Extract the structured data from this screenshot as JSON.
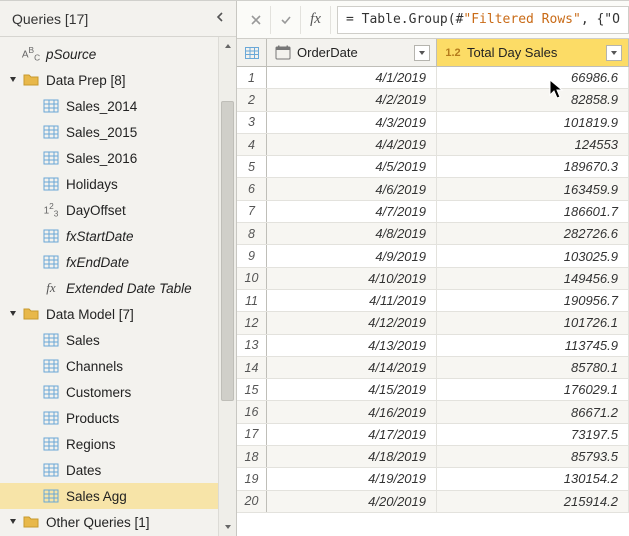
{
  "panel": {
    "title": "Queries [17]"
  },
  "tree": [
    {
      "id": "pSource",
      "label": "pSource",
      "indent": 0,
      "icon": "abc",
      "arrow": "",
      "selected": false,
      "italic": true
    },
    {
      "id": "dataprep",
      "label": "Data Prep [8]",
      "indent": 0,
      "icon": "folder",
      "arrow": "down",
      "selected": false
    },
    {
      "id": "s14",
      "label": "Sales_2014",
      "indent": 1,
      "icon": "table",
      "arrow": "",
      "selected": false
    },
    {
      "id": "s15",
      "label": "Sales_2015",
      "indent": 1,
      "icon": "table",
      "arrow": "",
      "selected": false
    },
    {
      "id": "s16",
      "label": "Sales_2016",
      "indent": 1,
      "icon": "table",
      "arrow": "",
      "selected": false
    },
    {
      "id": "hol",
      "label": "Holidays",
      "indent": 1,
      "icon": "table",
      "arrow": "",
      "selected": false
    },
    {
      "id": "dayoff",
      "label": "DayOffset",
      "indent": 1,
      "icon": "num",
      "arrow": "",
      "selected": false
    },
    {
      "id": "fxstart",
      "label": "fxStartDate",
      "indent": 1,
      "icon": "table",
      "arrow": "",
      "selected": false,
      "italic": true
    },
    {
      "id": "fxend",
      "label": "fxEndDate",
      "indent": 1,
      "icon": "table",
      "arrow": "",
      "selected": false,
      "italic": true
    },
    {
      "id": "ext",
      "label": "Extended Date Table",
      "indent": 1,
      "icon": "fx",
      "arrow": "",
      "selected": false,
      "italic": true
    },
    {
      "id": "dm",
      "label": "Data Model [7]",
      "indent": 0,
      "icon": "folder",
      "arrow": "down",
      "selected": false
    },
    {
      "id": "sales",
      "label": "Sales",
      "indent": 1,
      "icon": "table",
      "arrow": "",
      "selected": false
    },
    {
      "id": "chan",
      "label": "Channels",
      "indent": 1,
      "icon": "table",
      "arrow": "",
      "selected": false
    },
    {
      "id": "cust",
      "label": "Customers",
      "indent": 1,
      "icon": "table",
      "arrow": "",
      "selected": false
    },
    {
      "id": "prod",
      "label": "Products",
      "indent": 1,
      "icon": "table",
      "arrow": "",
      "selected": false
    },
    {
      "id": "reg",
      "label": "Regions",
      "indent": 1,
      "icon": "table",
      "arrow": "",
      "selected": false
    },
    {
      "id": "dates",
      "label": "Dates",
      "indent": 1,
      "icon": "table",
      "arrow": "",
      "selected": false
    },
    {
      "id": "sagg",
      "label": "Sales Agg",
      "indent": 1,
      "icon": "table",
      "arrow": "",
      "selected": true
    },
    {
      "id": "oq",
      "label": "Other Queries [1]",
      "indent": 0,
      "icon": "folder",
      "arrow": "down",
      "selected": false
    }
  ],
  "formula": {
    "prefix": "= Table.Group(#",
    "quoted": "\"Filtered Rows\"",
    "suffix": ", {\"O"
  },
  "columns": {
    "c1": "OrderDate",
    "c2": "Total Day Sales"
  },
  "rows": [
    {
      "n": "1",
      "d": "4/1/2019",
      "v": "66986.6"
    },
    {
      "n": "2",
      "d": "4/2/2019",
      "v": "82858.9"
    },
    {
      "n": "3",
      "d": "4/3/2019",
      "v": "101819.9"
    },
    {
      "n": "4",
      "d": "4/4/2019",
      "v": "124553"
    },
    {
      "n": "5",
      "d": "4/5/2019",
      "v": "189670.3"
    },
    {
      "n": "6",
      "d": "4/6/2019",
      "v": "163459.9"
    },
    {
      "n": "7",
      "d": "4/7/2019",
      "v": "186601.7"
    },
    {
      "n": "8",
      "d": "4/8/2019",
      "v": "282726.6"
    },
    {
      "n": "9",
      "d": "4/9/2019",
      "v": "103025.9"
    },
    {
      "n": "10",
      "d": "4/10/2019",
      "v": "149456.9"
    },
    {
      "n": "11",
      "d": "4/11/2019",
      "v": "190956.7"
    },
    {
      "n": "12",
      "d": "4/12/2019",
      "v": "101726.1"
    },
    {
      "n": "13",
      "d": "4/13/2019",
      "v": "113745.9"
    },
    {
      "n": "14",
      "d": "4/14/2019",
      "v": "85780.1"
    },
    {
      "n": "15",
      "d": "4/15/2019",
      "v": "176029.1"
    },
    {
      "n": "16",
      "d": "4/16/2019",
      "v": "86671.2"
    },
    {
      "n": "17",
      "d": "4/17/2019",
      "v": "73197.5"
    },
    {
      "n": "18",
      "d": "4/18/2019",
      "v": "85793.5"
    },
    {
      "n": "19",
      "d": "4/19/2019",
      "v": "130154.2"
    },
    {
      "n": "20",
      "d": "4/20/2019",
      "v": "215914.2"
    }
  ],
  "chart_data": {
    "type": "table",
    "title": "Sales Agg",
    "columns": [
      "OrderDate",
      "Total Day Sales"
    ],
    "rows": [
      [
        "4/1/2019",
        66986.6
      ],
      [
        "4/2/2019",
        82858.9
      ],
      [
        "4/3/2019",
        101819.9
      ],
      [
        "4/4/2019",
        124553
      ],
      [
        "4/5/2019",
        189670.3
      ],
      [
        "4/6/2019",
        163459.9
      ],
      [
        "4/7/2019",
        186601.7
      ],
      [
        "4/8/2019",
        282726.6
      ],
      [
        "4/9/2019",
        103025.9
      ],
      [
        "4/10/2019",
        149456.9
      ],
      [
        "4/11/2019",
        190956.7
      ],
      [
        "4/12/2019",
        101726.1
      ],
      [
        "4/13/2019",
        113745.9
      ],
      [
        "4/14/2019",
        85780.1
      ],
      [
        "4/15/2019",
        176029.1
      ],
      [
        "4/16/2019",
        86671.2
      ],
      [
        "4/17/2019",
        73197.5
      ],
      [
        "4/18/2019",
        85793.5
      ],
      [
        "4/19/2019",
        130154.2
      ],
      [
        "4/20/2019",
        215914.2
      ]
    ]
  }
}
